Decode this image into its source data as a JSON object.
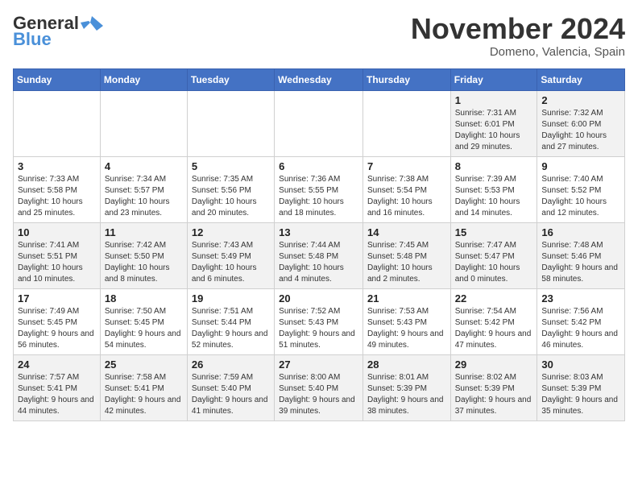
{
  "header": {
    "logo_line1": "General",
    "logo_line2": "Blue",
    "month": "November 2024",
    "location": "Domeno, Valencia, Spain"
  },
  "columns": [
    "Sunday",
    "Monday",
    "Tuesday",
    "Wednesday",
    "Thursday",
    "Friday",
    "Saturday"
  ],
  "weeks": [
    [
      {
        "day": "",
        "info": ""
      },
      {
        "day": "",
        "info": ""
      },
      {
        "day": "",
        "info": ""
      },
      {
        "day": "",
        "info": ""
      },
      {
        "day": "",
        "info": ""
      },
      {
        "day": "1",
        "info": "Sunrise: 7:31 AM\nSunset: 6:01 PM\nDaylight: 10 hours and 29 minutes."
      },
      {
        "day": "2",
        "info": "Sunrise: 7:32 AM\nSunset: 6:00 PM\nDaylight: 10 hours and 27 minutes."
      }
    ],
    [
      {
        "day": "3",
        "info": "Sunrise: 7:33 AM\nSunset: 5:58 PM\nDaylight: 10 hours and 25 minutes."
      },
      {
        "day": "4",
        "info": "Sunrise: 7:34 AM\nSunset: 5:57 PM\nDaylight: 10 hours and 23 minutes."
      },
      {
        "day": "5",
        "info": "Sunrise: 7:35 AM\nSunset: 5:56 PM\nDaylight: 10 hours and 20 minutes."
      },
      {
        "day": "6",
        "info": "Sunrise: 7:36 AM\nSunset: 5:55 PM\nDaylight: 10 hours and 18 minutes."
      },
      {
        "day": "7",
        "info": "Sunrise: 7:38 AM\nSunset: 5:54 PM\nDaylight: 10 hours and 16 minutes."
      },
      {
        "day": "8",
        "info": "Sunrise: 7:39 AM\nSunset: 5:53 PM\nDaylight: 10 hours and 14 minutes."
      },
      {
        "day": "9",
        "info": "Sunrise: 7:40 AM\nSunset: 5:52 PM\nDaylight: 10 hours and 12 minutes."
      }
    ],
    [
      {
        "day": "10",
        "info": "Sunrise: 7:41 AM\nSunset: 5:51 PM\nDaylight: 10 hours and 10 minutes."
      },
      {
        "day": "11",
        "info": "Sunrise: 7:42 AM\nSunset: 5:50 PM\nDaylight: 10 hours and 8 minutes."
      },
      {
        "day": "12",
        "info": "Sunrise: 7:43 AM\nSunset: 5:49 PM\nDaylight: 10 hours and 6 minutes."
      },
      {
        "day": "13",
        "info": "Sunrise: 7:44 AM\nSunset: 5:48 PM\nDaylight: 10 hours and 4 minutes."
      },
      {
        "day": "14",
        "info": "Sunrise: 7:45 AM\nSunset: 5:48 PM\nDaylight: 10 hours and 2 minutes."
      },
      {
        "day": "15",
        "info": "Sunrise: 7:47 AM\nSunset: 5:47 PM\nDaylight: 10 hours and 0 minutes."
      },
      {
        "day": "16",
        "info": "Sunrise: 7:48 AM\nSunset: 5:46 PM\nDaylight: 9 hours and 58 minutes."
      }
    ],
    [
      {
        "day": "17",
        "info": "Sunrise: 7:49 AM\nSunset: 5:45 PM\nDaylight: 9 hours and 56 minutes."
      },
      {
        "day": "18",
        "info": "Sunrise: 7:50 AM\nSunset: 5:45 PM\nDaylight: 9 hours and 54 minutes."
      },
      {
        "day": "19",
        "info": "Sunrise: 7:51 AM\nSunset: 5:44 PM\nDaylight: 9 hours and 52 minutes."
      },
      {
        "day": "20",
        "info": "Sunrise: 7:52 AM\nSunset: 5:43 PM\nDaylight: 9 hours and 51 minutes."
      },
      {
        "day": "21",
        "info": "Sunrise: 7:53 AM\nSunset: 5:43 PM\nDaylight: 9 hours and 49 minutes."
      },
      {
        "day": "22",
        "info": "Sunrise: 7:54 AM\nSunset: 5:42 PM\nDaylight: 9 hours and 47 minutes."
      },
      {
        "day": "23",
        "info": "Sunrise: 7:56 AM\nSunset: 5:42 PM\nDaylight: 9 hours and 46 minutes."
      }
    ],
    [
      {
        "day": "24",
        "info": "Sunrise: 7:57 AM\nSunset: 5:41 PM\nDaylight: 9 hours and 44 minutes."
      },
      {
        "day": "25",
        "info": "Sunrise: 7:58 AM\nSunset: 5:41 PM\nDaylight: 9 hours and 42 minutes."
      },
      {
        "day": "26",
        "info": "Sunrise: 7:59 AM\nSunset: 5:40 PM\nDaylight: 9 hours and 41 minutes."
      },
      {
        "day": "27",
        "info": "Sunrise: 8:00 AM\nSunset: 5:40 PM\nDaylight: 9 hours and 39 minutes."
      },
      {
        "day": "28",
        "info": "Sunrise: 8:01 AM\nSunset: 5:39 PM\nDaylight: 9 hours and 38 minutes."
      },
      {
        "day": "29",
        "info": "Sunrise: 8:02 AM\nSunset: 5:39 PM\nDaylight: 9 hours and 37 minutes."
      },
      {
        "day": "30",
        "info": "Sunrise: 8:03 AM\nSunset: 5:39 PM\nDaylight: 9 hours and 35 minutes."
      }
    ]
  ]
}
